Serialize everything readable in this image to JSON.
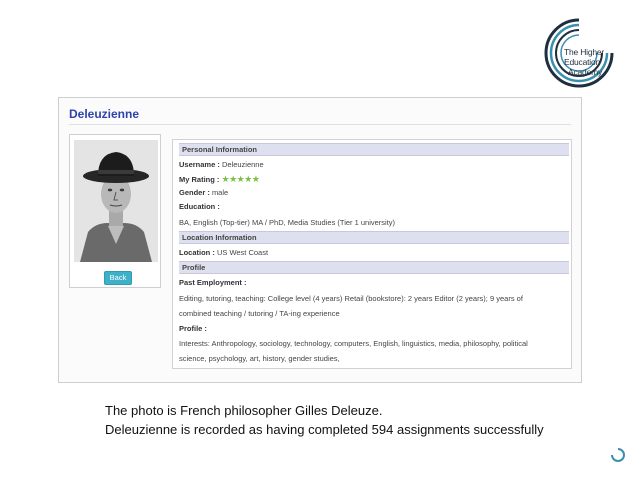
{
  "logo": {
    "lines": [
      "The Higher",
      "Education",
      "Academy"
    ],
    "icon": "circle-arcs-logo"
  },
  "profile": {
    "title": "Deleuzienne",
    "back_label": "Back",
    "sections": {
      "personal": "Personal Information",
      "location": "Location Information",
      "profile": "Profile"
    },
    "username_label": "Username :",
    "username_value": "Deleuzienne",
    "rating_label": "My Rating :",
    "rating_value": 5,
    "rating_max": 5,
    "gender_label": "Gender :",
    "gender_value": "male",
    "education_label": "Education :",
    "education_value": "BA, English (Top-tier) MA / PhD, Media Studies (Tier 1 university)",
    "location_label": "Location :",
    "location_value": "US West Coast",
    "past_employment_label": "Past Employment :",
    "past_employment_line1": "Editing, tutoring, teaching: College level (4 years) Retail (bookstore): 2 years Editor (2 years); 9 years of",
    "past_employment_line2": "combined teaching / tutoring / TA-ing experience",
    "profile_label": "Profile :",
    "interests_line1": "Interests: Anthropology, sociology, technology, computers, English, linguistics, media, philosophy, political",
    "interests_line2": "science, psychology, art, history, gender studies,"
  },
  "caption": {
    "line1": "The photo is French philosopher Gilles Deleuze.",
    "line2": "Deleuzienne is recorded as having completed 594 assignments successfully"
  },
  "colors": {
    "title": "#2c44a8",
    "section_header": "#dfe0ef",
    "button": "#3fb0c9",
    "stars": "#7ac142"
  }
}
